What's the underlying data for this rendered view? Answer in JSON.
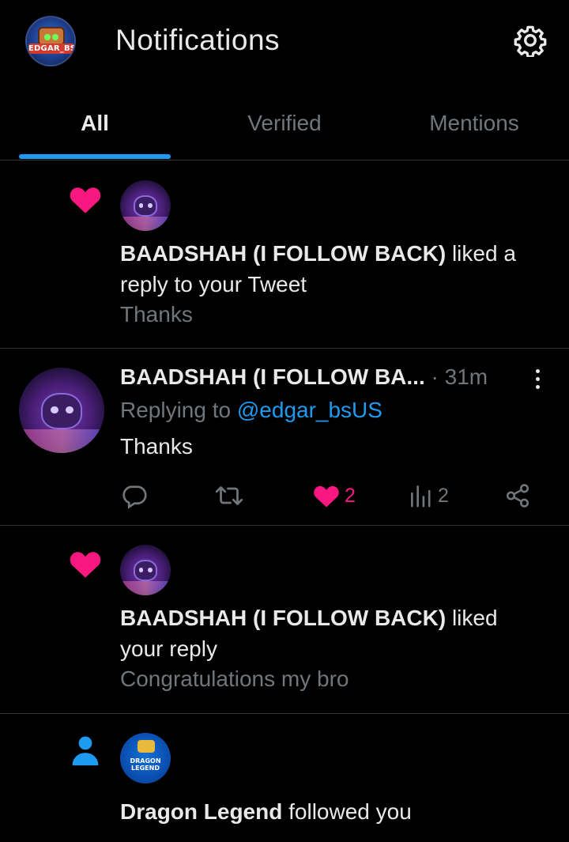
{
  "header": {
    "title": "Notifications",
    "profile_badge": "EDGAR_BS"
  },
  "tabs": [
    {
      "label": "All",
      "active": true
    },
    {
      "label": "Verified",
      "active": false
    },
    {
      "label": "Mentions",
      "active": false
    }
  ],
  "notifications": [
    {
      "type": "like",
      "icon": "heart-icon",
      "actor": "BAADSHAH (I FOLLOW BACK)",
      "action_line1": " liked a",
      "action_line2": "reply to your Tweet",
      "snippet": "Thanks"
    },
    {
      "type": "tweet",
      "author": "BAADSHAH (I FOLLOW BA...",
      "time": " · 31m",
      "replying_prefix": "Replying to ",
      "replying_handle": "@edgar_bsUS",
      "body": "Thanks",
      "likes": "2",
      "views": "2"
    },
    {
      "type": "like",
      "icon": "heart-icon",
      "actor": "BAADSHAH (I FOLLOW BACK)",
      "action_line1": " liked",
      "action_line2": "your reply",
      "snippet": "Congratulations my bro"
    },
    {
      "type": "follow",
      "icon": "person-icon",
      "actor": "Dragon Legend",
      "action": " followed you",
      "avatar_text": "DRAGON LEGEND"
    }
  ],
  "colors": {
    "background": "#000000",
    "accent_blue": "#1d9bf0",
    "like_pink": "#f91880",
    "muted": "#71767b",
    "divider": "#2f3336"
  }
}
